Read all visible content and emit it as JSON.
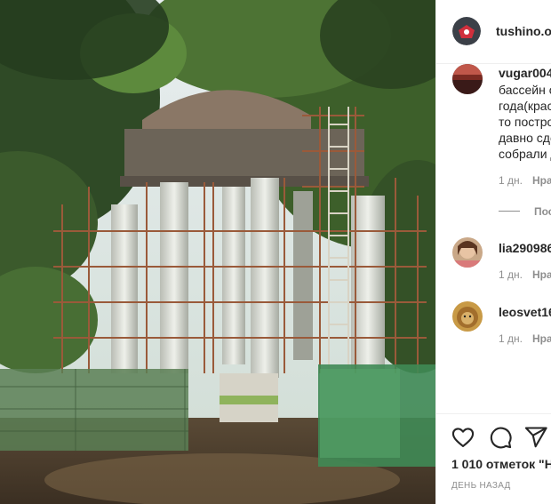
{
  "post": {
    "author": "tushino.o",
    "likes_text": "1 010 отметок \"Н",
    "date_text": "ДЕНЬ НАЗАД"
  },
  "comments": [
    {
      "username": "vugar004",
      "lines": [
        "бассейн с",
        "года(крас",
        "то постро",
        "давно сде",
        "собрали д"
      ],
      "time": "1 дн.",
      "like_label": "Нра",
      "replies_label": "Пос"
    },
    {
      "username": "lia290986",
      "time": "1 дн.",
      "like_label": "Нра"
    },
    {
      "username": "leosvet16",
      "time": "1 дн.",
      "like_label": "Нра"
    }
  ],
  "colors": {
    "text": "#262626",
    "secondary": "#8e8e8e",
    "divider": "#efefef"
  },
  "icons": [
    "heart-icon",
    "comment-icon",
    "share-icon"
  ]
}
